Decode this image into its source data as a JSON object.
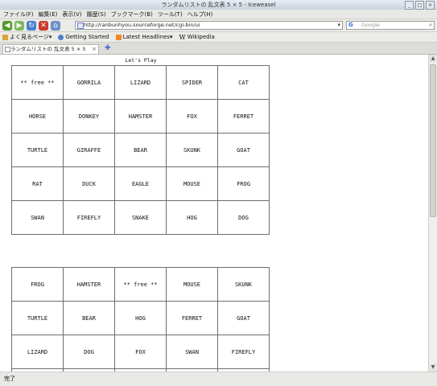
{
  "window": {
    "title": "ランダムリストの 乱文表 5 × 5 - Iceweasel"
  },
  "menubar": {
    "items": [
      "ファイル(F)",
      "編集(E)",
      "表示(V)",
      "履歴(S)",
      "ブックマーク(B)",
      "ツール(T)",
      "ヘルプ(H)"
    ]
  },
  "navbar": {
    "url": "http://ranbunhyou.sourceforge.net/cgi-bin/ui",
    "search_placeholder": "Google"
  },
  "bookmarks": {
    "items": [
      "よく見るページ▾",
      "Getting Started",
      "Latest Headlines▾",
      "Wikipedia"
    ]
  },
  "tab": {
    "label": "ランダムリストの 乱文表 5 × 5"
  },
  "content": {
    "caption": "Let's Play",
    "card1": [
      [
        "** free **",
        "GORRILA",
        "LIZARD",
        "SPIDER",
        "CAT"
      ],
      [
        "HORSE",
        "DONKEY",
        "HAMSTER",
        "FOX",
        "FERRET"
      ],
      [
        "TURTLE",
        "GIRAFFE",
        "BEAR",
        "SKUNK",
        "GOAT"
      ],
      [
        "RAT",
        "DUCK",
        "EAGLE",
        "MOUSE",
        "FROG"
      ],
      [
        "SWAN",
        "FIREFLY",
        "SNAKE",
        "HOG",
        "DOG"
      ]
    ],
    "card2": [
      [
        "FROG",
        "HAMSTER",
        "** free **",
        "MOUSE",
        "SKUNK"
      ],
      [
        "TURTLE",
        "BEAR",
        "HOG",
        "FERRET",
        "GOAT"
      ],
      [
        "LIZARD",
        "DOG",
        "FOX",
        "SWAN",
        "FIREFLY"
      ]
    ]
  },
  "status": {
    "text": "完了"
  }
}
